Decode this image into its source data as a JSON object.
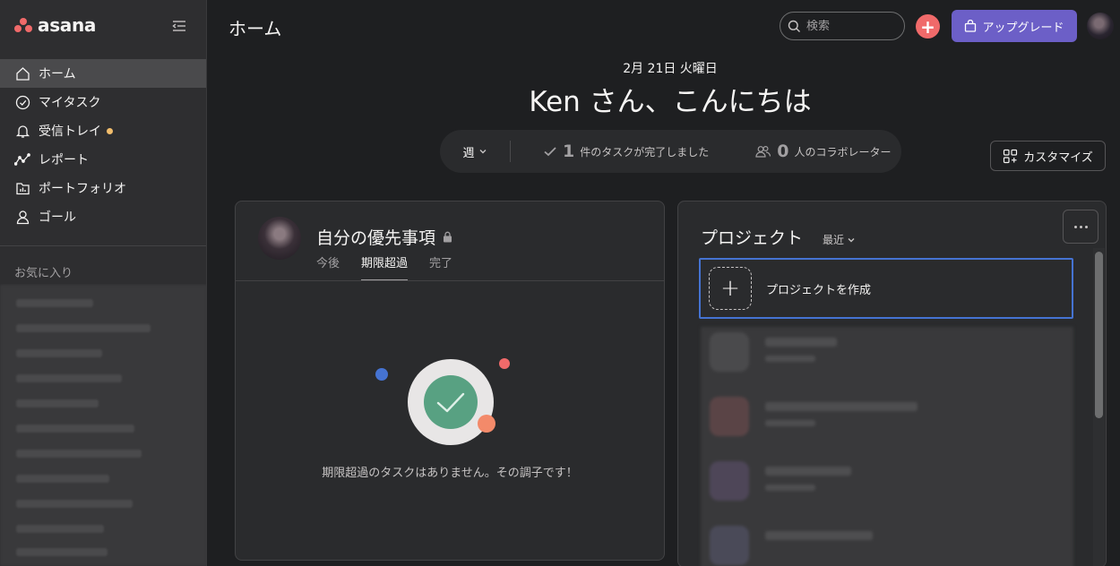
{
  "sidebar": {
    "brand": "asana",
    "nav": [
      {
        "label": "ホーム",
        "icon": "home-icon",
        "active": true
      },
      {
        "label": "マイタスク",
        "icon": "check-circle-icon"
      },
      {
        "label": "受信トレイ",
        "icon": "bell-icon",
        "badge": true
      },
      {
        "label": "レポート",
        "icon": "trend-line-icon"
      },
      {
        "label": "ポートフォリオ",
        "icon": "folder-chart-icon"
      },
      {
        "label": "ゴール",
        "icon": "person-icon"
      }
    ],
    "favorites_title": "お気に入り"
  },
  "header": {
    "title": "ホーム",
    "search_placeholder": "検索",
    "upgrade_label": "アップグレード"
  },
  "greeting": {
    "date": "2月 21日 火曜日",
    "message": "Ken さん、こんにちは"
  },
  "stats": {
    "period": "週",
    "tasks_done_count": "1",
    "tasks_done_label": "件のタスクが完了しました",
    "collaborators_count": "0",
    "collaborators_label": "人のコラボレーター"
  },
  "customize_label": "カスタマイズ",
  "priority": {
    "title": "自分の優先事項",
    "tabs": [
      {
        "label": "今後",
        "active": false
      },
      {
        "label": "期限超過",
        "active": true
      },
      {
        "label": "完了",
        "active": false
      }
    ],
    "empty_message": "期限超過のタスクはありません。その調子です！"
  },
  "projects": {
    "title": "プロジェクト",
    "sort_label": "最近",
    "create_label": "プロジェクトを作成"
  },
  "colors": {
    "accent_coral": "#f06a6a",
    "upgrade_purple": "#6c5fc7",
    "selection_blue": "#4573d2",
    "check_green": "#58a182"
  }
}
